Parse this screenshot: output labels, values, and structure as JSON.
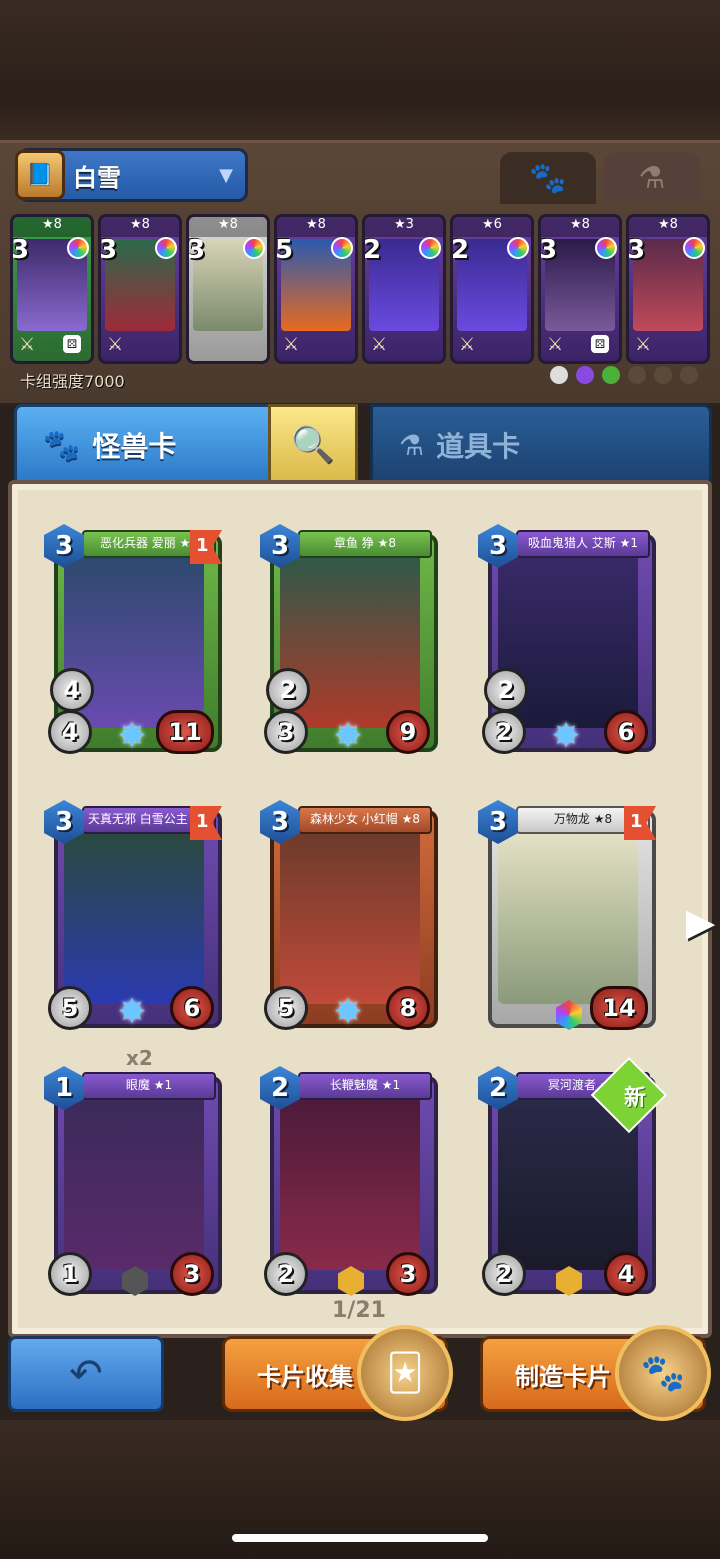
{
  "deck_header": {
    "deck_name": "白雪",
    "deck_strength": "卡组强度7000"
  },
  "deck_cards": [
    {
      "stars": "★8",
      "cost": "3",
      "style": "green"
    },
    {
      "stars": "★8",
      "cost": "3",
      "style": "purple"
    },
    {
      "stars": "★8",
      "cost": "3",
      "style": "gray"
    },
    {
      "stars": "★8",
      "cost": "5",
      "style": "purple"
    },
    {
      "stars": "★3",
      "cost": "2",
      "style": "purple"
    },
    {
      "stars": "★6",
      "cost": "2",
      "style": "purple"
    },
    {
      "stars": "★8",
      "cost": "3",
      "style": "purple"
    },
    {
      "stars": "★8",
      "cost": "3",
      "style": "purple"
    }
  ],
  "type_tabs": {
    "monster": "怪兽卡",
    "items": "道具卡"
  },
  "cards": [
    {
      "name": "恶化兵器 爱丽 ★8",
      "cost": "3",
      "flag": "1",
      "mid": "4",
      "atk": "4",
      "hp": "11",
      "style": "green"
    },
    {
      "name": "章鱼 狰 ★8",
      "cost": "3",
      "flag": "",
      "mid": "2",
      "atk": "3",
      "hp": "9",
      "style": "green"
    },
    {
      "name": "吸血鬼猎人 艾斯 ★1",
      "cost": "3",
      "flag": "",
      "mid": "2",
      "atk": "2",
      "hp": "6",
      "style": "purple"
    },
    {
      "name": "天真无邪 白雪公主 ★8",
      "cost": "3",
      "flag": "1",
      "mid": "",
      "atk": "5",
      "hp": "6",
      "style": "purple"
    },
    {
      "name": "森林少女 小红帽 ★8",
      "cost": "3",
      "flag": "",
      "mid": "",
      "atk": "5",
      "hp": "8",
      "style": "orange"
    },
    {
      "name": "万物龙 ★8",
      "cost": "3",
      "flag": "1",
      "mid": "",
      "atk": "",
      "hp": "14",
      "style": "gray"
    },
    {
      "name": "眼魔 ★1",
      "cost": "1",
      "flag": "",
      "mid": "",
      "atk": "1",
      "hp": "3",
      "style": "purple"
    },
    {
      "name": "长鞭魅魔 ★1",
      "cost": "2",
      "flag": "",
      "mid": "",
      "atk": "2",
      "hp": "3",
      "style": "purple"
    },
    {
      "name": "冥河渡者 ★1",
      "cost": "2",
      "flag": "",
      "mid": "",
      "atk": "2",
      "hp": "4",
      "style": "purple"
    }
  ],
  "multiplier": "x2",
  "new_badge": "新",
  "page_indicator": "1/21",
  "buttons": {
    "collect": "卡片收集",
    "craft": "制造卡片"
  },
  "icons": {
    "back": "back-arrow-icon",
    "search": "magnifier-icon",
    "monster_tab": "paw-icon",
    "items_tab": "potion-icon",
    "next": "chevron-right-icon"
  }
}
